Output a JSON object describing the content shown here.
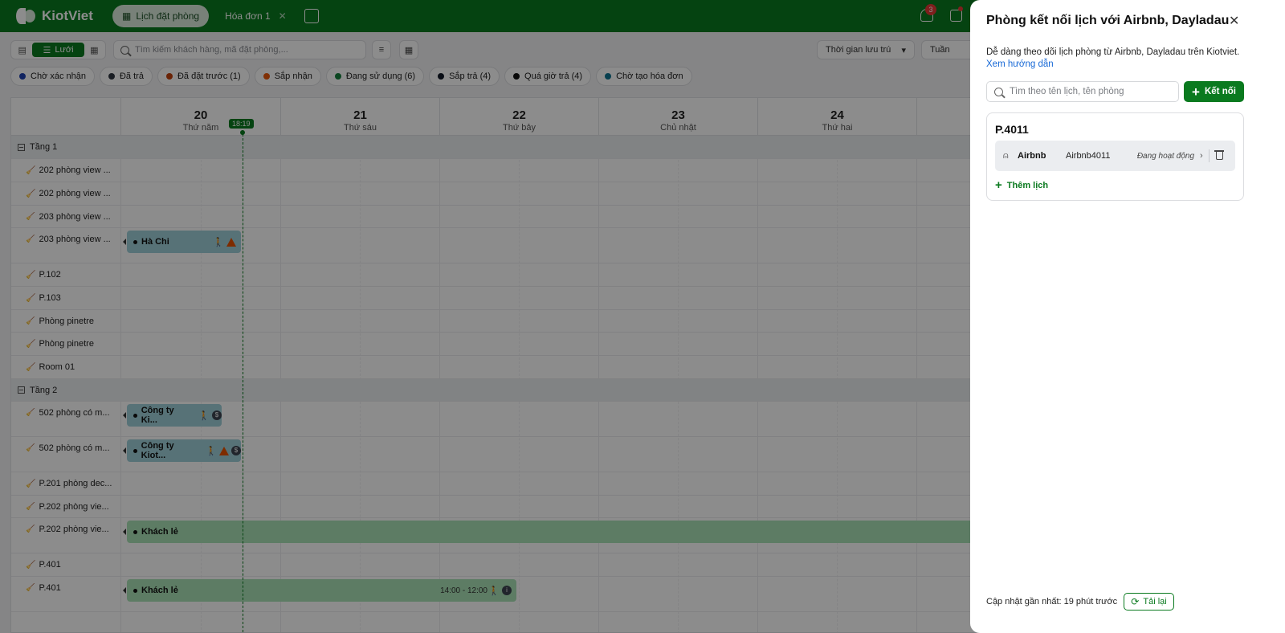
{
  "topbar": {
    "brand": "KiotViet",
    "tabs": [
      {
        "label": "Lịch đặt phòng"
      },
      {
        "label": "Hóa đơn 1"
      }
    ],
    "notification_count": "3"
  },
  "toolbar": {
    "view_toggle_label": "Lưới",
    "search_placeholder": "Tìm kiếm khách hàng, mã đặt phòng,...",
    "time_filter": "Thời gian lưu trú",
    "period": "Tuần"
  },
  "filters": [
    {
      "label": "Chờ xác nhận",
      "color": "#1e40af"
    },
    {
      "label": "Đã trả",
      "color": "#2f3640"
    },
    {
      "label": "Đã đặt trước (1)",
      "color": "#c2410c"
    },
    {
      "label": "Sắp nhận",
      "color": "#ea580c"
    },
    {
      "label": "Đang sử dụng (6)",
      "color": "#15803d"
    },
    {
      "label": "Sắp trả (4)",
      "color": "#111827"
    },
    {
      "label": "Quá giờ trả (4)",
      "color": "#111111"
    },
    {
      "label": "Chờ tạo hóa đơn",
      "color": "#0e7490"
    }
  ],
  "calendar": {
    "now_time": "18:19",
    "days": [
      {
        "num": "20",
        "name": "Thứ năm"
      },
      {
        "num": "21",
        "name": "Thứ sáu"
      },
      {
        "num": "22",
        "name": "Thứ bảy"
      },
      {
        "num": "23",
        "name": "Chủ nhật"
      },
      {
        "num": "24",
        "name": "Thứ hai"
      }
    ],
    "rows": [
      {
        "label": "Tầng 1"
      },
      {
        "label": "202 phòng view ..."
      },
      {
        "label": "202 phòng view ..."
      },
      {
        "label": "203 phòng view ..."
      },
      {
        "label": "203 phòng view ..."
      },
      {
        "label": "P.102"
      },
      {
        "label": "P.103"
      },
      {
        "label": "Phòng pinetre"
      },
      {
        "label": "Phòng pinetre"
      },
      {
        "label": "Room 01"
      },
      {
        "label": "Tầng 2"
      },
      {
        "label": "502 phòng có m..."
      },
      {
        "label": "502 phòng có m..."
      },
      {
        "label": "P.201 phòng dec..."
      },
      {
        "label": "P.202 phòng vie..."
      },
      {
        "label": "P.202 phòng vie..."
      },
      {
        "label": "P.401"
      },
      {
        "label": "P.401"
      }
    ],
    "bookings": [
      {
        "guest": "Hà Chi"
      },
      {
        "guest": "Công ty Ki...",
        "badge": "$"
      },
      {
        "guest": "Công ty Kiot...",
        "badge": "$"
      },
      {
        "guest": "Khách lẻ"
      },
      {
        "guest": "Khách lẻ",
        "time": "14:00 - 12:00",
        "badge": "i"
      }
    ]
  },
  "drawer": {
    "title": "Phòng kết nối lịch với Airbnb, Dayladau",
    "description": "Dễ dàng theo dõi lịch phòng từ Airbnb, Dayladau trên Kiotviet.",
    "guide_link": "Xem hướng dẫn",
    "search_placeholder": "Tìm theo tên lịch, tên phòng",
    "connect_label": "Kết nối",
    "room": "P.4011",
    "calendar_item": {
      "platform": "Airbnb",
      "name": "Airbnb4011",
      "status": "Đang hoạt động"
    },
    "add_calendar_label": "Thêm lịch",
    "last_updated": "Cập nhật gần nhất: 19 phút trước",
    "reload_label": "Tải lại"
  },
  "colors": {
    "brand_green": "#0a7a1f",
    "link_blue": "#1668d6",
    "booking_blue": "#9fd0d9",
    "booking_green": "#a9e2b6"
  }
}
